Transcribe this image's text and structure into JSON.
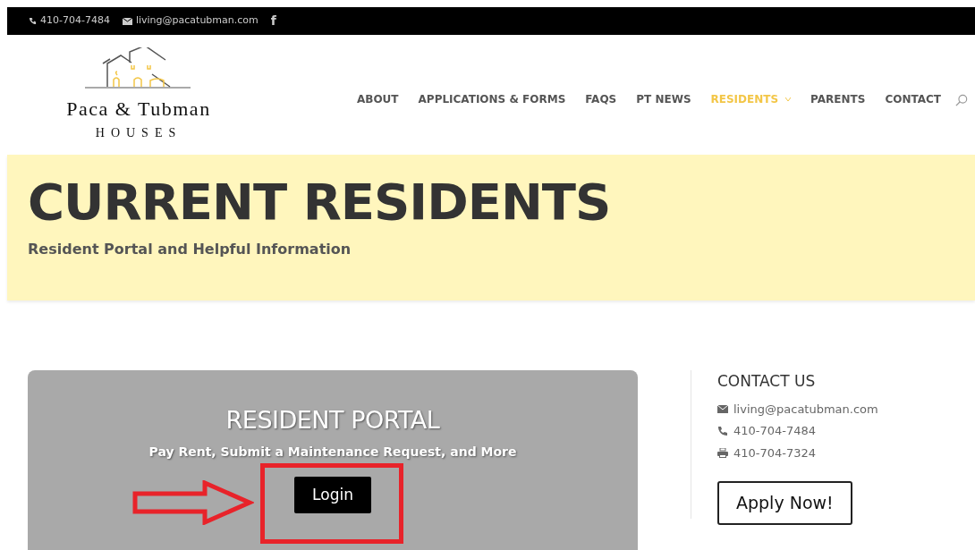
{
  "top_bar": {
    "phone": "410-704-7484",
    "email": "living@pacatubman.com",
    "social": "f"
  },
  "logo": {
    "name": "Paca & Tubman",
    "sub": "HOUSES"
  },
  "nav": [
    {
      "label": "ABOUT",
      "selected": false,
      "dropdown": false
    },
    {
      "label": "APPLICATIONS & FORMS",
      "selected": false,
      "dropdown": false
    },
    {
      "label": "FAQS",
      "selected": false,
      "dropdown": false
    },
    {
      "label": "PT NEWS",
      "selected": false,
      "dropdown": false
    },
    {
      "label": "RESIDENTS",
      "selected": true,
      "dropdown": true
    },
    {
      "label": "PARENTS",
      "selected": false,
      "dropdown": false
    },
    {
      "label": "CONTACT",
      "selected": false,
      "dropdown": false
    }
  ],
  "hero": {
    "title": "CURRENT RESIDENTS",
    "subtitle": "Resident Portal and Helpful Information"
  },
  "portal": {
    "title": "RESIDENT PORTAL",
    "subtitle": "Pay Rent, Submit a Maintenance Request, and More",
    "button": "Login"
  },
  "contact": {
    "heading": "CONTACT US",
    "lines": [
      {
        "kind": "email",
        "text": "living@pacatubman.com"
      },
      {
        "kind": "phone",
        "text": "410-704-7484"
      },
      {
        "kind": "fax",
        "text": "410-704-7324"
      }
    ],
    "button": "Apply Now!"
  }
}
